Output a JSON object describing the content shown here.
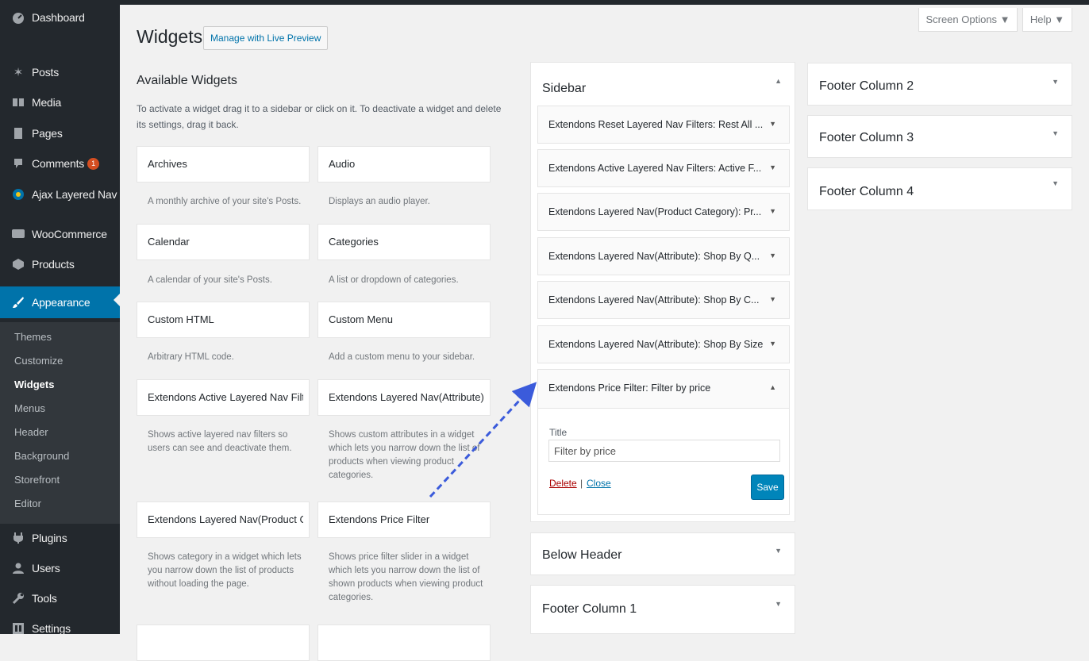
{
  "admin_menu": {
    "items": [
      {
        "label": "Dashboard",
        "icon": "dashboard-icon"
      },
      {
        "label": "Posts",
        "icon": "pin-icon"
      },
      {
        "label": "Media",
        "icon": "media-icon"
      },
      {
        "label": "Pages",
        "icon": "pages-icon"
      },
      {
        "label": "Comments",
        "icon": "comments-icon",
        "badge": "1"
      },
      {
        "label": "Ajax Layered Nav",
        "icon": "filter-icon"
      },
      {
        "label": "WooCommerce",
        "icon": "woocommerce-icon"
      },
      {
        "label": "Products",
        "icon": "products-icon"
      },
      {
        "label": "Appearance",
        "icon": "paintbrush-icon"
      },
      {
        "label": "Plugins",
        "icon": "plugins-icon"
      },
      {
        "label": "Users",
        "icon": "users-icon"
      },
      {
        "label": "Tools",
        "icon": "wrench-icon"
      },
      {
        "label": "Settings",
        "icon": "settings-icon"
      }
    ],
    "submenu": [
      "Themes",
      "Customize",
      "Widgets",
      "Menus",
      "Header",
      "Background",
      "Storefront",
      "Editor"
    ],
    "active_item": "Appearance",
    "current_subitem": "Widgets"
  },
  "topbar": {
    "screen_options": "Screen Options ▼",
    "help": "Help ▼"
  },
  "page": {
    "title": "Widgets",
    "live_preview_button": "Manage with Live Preview"
  },
  "available": {
    "title": "Available Widgets",
    "description": "To activate a widget drag it to a sidebar or click on it. To deactivate a widget and delete its settings, drag it back.",
    "widgets": [
      {
        "title": "Archives",
        "desc": "A monthly archive of your site's Posts."
      },
      {
        "title": "Audio",
        "desc": "Displays an audio player."
      },
      {
        "title": "Calendar",
        "desc": "A calendar of your site's Posts."
      },
      {
        "title": "Categories",
        "desc": "A list or dropdown of categories."
      },
      {
        "title": "Custom HTML",
        "desc": "Arbitrary HTML code."
      },
      {
        "title": "Custom Menu",
        "desc": "Add a custom menu to your sidebar."
      },
      {
        "title": "Extendons Active Layered Nav Filt...",
        "desc": "Shows active layered nav filters so users can see and deactivate them."
      },
      {
        "title": "Extendons Layered Nav(Attribute)",
        "desc": "Shows custom attributes in a widget which lets you narrow down the list of products when viewing product categories."
      },
      {
        "title": "Extendons Layered Nav(Product C...",
        "desc": "Shows category in a widget which lets you narrow down the list of products without loading the page."
      },
      {
        "title": "Extendons Price Filter",
        "desc": "Shows price filter slider in a widget which lets you narrow down the list of shown products when viewing product categories."
      }
    ]
  },
  "sidebar_area": {
    "title": "Sidebar",
    "widgets": [
      {
        "title": "Extendons Reset Layered Nav Filters: Rest All ..."
      },
      {
        "title": "Extendons Active Layered Nav Filters: Active F..."
      },
      {
        "title": "Extendons Layered Nav(Product Category): Pr..."
      },
      {
        "title": "Extendons Layered Nav(Attribute): Shop By Q..."
      },
      {
        "title": "Extendons Layered Nav(Attribute): Shop By C..."
      },
      {
        "title": "Extendons Layered Nav(Attribute): Shop By Size"
      }
    ],
    "expanded_widget": {
      "title": "Extendons Price Filter: Filter by price",
      "field_label": "Title",
      "field_value": "Filter by price",
      "delete": "Delete",
      "separator": "|",
      "close": "Close",
      "save": "Save"
    }
  },
  "other_areas": [
    {
      "title": "Below Header"
    },
    {
      "title": "Footer Column 1"
    },
    {
      "title": "Footer Column 2"
    },
    {
      "title": "Footer Column 3"
    },
    {
      "title": "Footer Column 4"
    }
  ],
  "colors": {
    "admin_bg": "#23282d",
    "submenu_bg": "#32373c",
    "accent": "#0073aa",
    "save_button": "#0085ba",
    "badge": "#d54e21",
    "delete_link": "#a00000",
    "drag_arrow": "#3b5bdb"
  }
}
